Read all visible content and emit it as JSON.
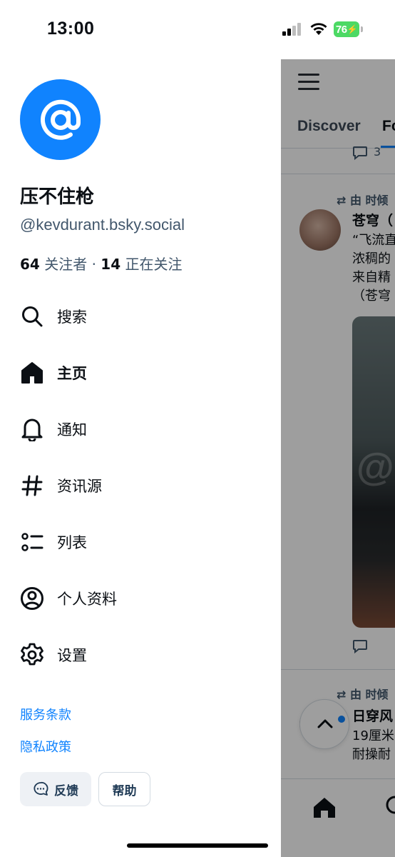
{
  "status_bar": {
    "time": "13:00",
    "battery": "76"
  },
  "profile": {
    "avatar_icon": "at-sign-icon",
    "display_name": "压不住枪",
    "handle": "@kevdurant.bsky.social",
    "followers_count": "64",
    "followers_label": "关注者",
    "separator": "·",
    "following_count": "14",
    "following_label": "正在关注"
  },
  "nav": {
    "items": [
      {
        "label": "搜索",
        "icon": "search-icon"
      },
      {
        "label": "主页",
        "icon": "home-icon",
        "active": true
      },
      {
        "label": "通知",
        "icon": "bell-icon"
      },
      {
        "label": "资讯源",
        "icon": "hash-icon"
      },
      {
        "label": "列表",
        "icon": "list-icon"
      },
      {
        "label": "个人资料",
        "icon": "profile-icon"
      },
      {
        "label": "设置",
        "icon": "gear-icon"
      }
    ]
  },
  "footer": {
    "terms": "服务条款",
    "privacy": "隐私政策",
    "feedback": "反馈",
    "help": "帮助"
  },
  "feed": {
    "tabs": [
      "Discover",
      "Fo"
    ],
    "post1_reply_count": "3",
    "post2": {
      "repost_label": "由 时倾",
      "author": "苍穹（",
      "text_lines": [
        "“飞流直",
        "浓稠的",
        "来自精",
        "（苍穹"
      ]
    },
    "post3": {
      "repost_label": "由 时倾",
      "author": "日穿风",
      "text_lines": [
        "19厘米",
        "耐操耐"
      ]
    }
  },
  "colors": {
    "accent": "#1083fe",
    "text": "#0b0f14",
    "muted": "#42576c"
  }
}
